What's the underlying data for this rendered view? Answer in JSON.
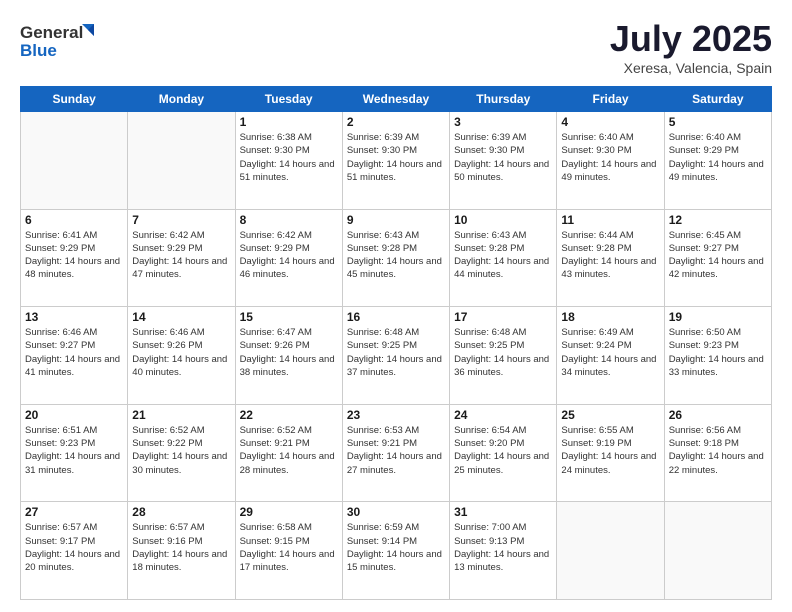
{
  "logo": {
    "line1": "General",
    "line2": "Blue"
  },
  "title": "July 2025",
  "location": "Xeresa, Valencia, Spain",
  "weekdays": [
    "Sunday",
    "Monday",
    "Tuesday",
    "Wednesday",
    "Thursday",
    "Friday",
    "Saturday"
  ],
  "days": [
    {
      "num": "",
      "info": null
    },
    {
      "num": "",
      "info": null
    },
    {
      "num": "1",
      "info": {
        "sunrise": "Sunrise: 6:38 AM",
        "sunset": "Sunset: 9:30 PM",
        "daylight": "Daylight: 14 hours and 51 minutes."
      }
    },
    {
      "num": "2",
      "info": {
        "sunrise": "Sunrise: 6:39 AM",
        "sunset": "Sunset: 9:30 PM",
        "daylight": "Daylight: 14 hours and 51 minutes."
      }
    },
    {
      "num": "3",
      "info": {
        "sunrise": "Sunrise: 6:39 AM",
        "sunset": "Sunset: 9:30 PM",
        "daylight": "Daylight: 14 hours and 50 minutes."
      }
    },
    {
      "num": "4",
      "info": {
        "sunrise": "Sunrise: 6:40 AM",
        "sunset": "Sunset: 9:30 PM",
        "daylight": "Daylight: 14 hours and 49 minutes."
      }
    },
    {
      "num": "5",
      "info": {
        "sunrise": "Sunrise: 6:40 AM",
        "sunset": "Sunset: 9:29 PM",
        "daylight": "Daylight: 14 hours and 49 minutes."
      }
    },
    {
      "num": "6",
      "info": {
        "sunrise": "Sunrise: 6:41 AM",
        "sunset": "Sunset: 9:29 PM",
        "daylight": "Daylight: 14 hours and 48 minutes."
      }
    },
    {
      "num": "7",
      "info": {
        "sunrise": "Sunrise: 6:42 AM",
        "sunset": "Sunset: 9:29 PM",
        "daylight": "Daylight: 14 hours and 47 minutes."
      }
    },
    {
      "num": "8",
      "info": {
        "sunrise": "Sunrise: 6:42 AM",
        "sunset": "Sunset: 9:29 PM",
        "daylight": "Daylight: 14 hours and 46 minutes."
      }
    },
    {
      "num": "9",
      "info": {
        "sunrise": "Sunrise: 6:43 AM",
        "sunset": "Sunset: 9:28 PM",
        "daylight": "Daylight: 14 hours and 45 minutes."
      }
    },
    {
      "num": "10",
      "info": {
        "sunrise": "Sunrise: 6:43 AM",
        "sunset": "Sunset: 9:28 PM",
        "daylight": "Daylight: 14 hours and 44 minutes."
      }
    },
    {
      "num": "11",
      "info": {
        "sunrise": "Sunrise: 6:44 AM",
        "sunset": "Sunset: 9:28 PM",
        "daylight": "Daylight: 14 hours and 43 minutes."
      }
    },
    {
      "num": "12",
      "info": {
        "sunrise": "Sunrise: 6:45 AM",
        "sunset": "Sunset: 9:27 PM",
        "daylight": "Daylight: 14 hours and 42 minutes."
      }
    },
    {
      "num": "13",
      "info": {
        "sunrise": "Sunrise: 6:46 AM",
        "sunset": "Sunset: 9:27 PM",
        "daylight": "Daylight: 14 hours and 41 minutes."
      }
    },
    {
      "num": "14",
      "info": {
        "sunrise": "Sunrise: 6:46 AM",
        "sunset": "Sunset: 9:26 PM",
        "daylight": "Daylight: 14 hours and 40 minutes."
      }
    },
    {
      "num": "15",
      "info": {
        "sunrise": "Sunrise: 6:47 AM",
        "sunset": "Sunset: 9:26 PM",
        "daylight": "Daylight: 14 hours and 38 minutes."
      }
    },
    {
      "num": "16",
      "info": {
        "sunrise": "Sunrise: 6:48 AM",
        "sunset": "Sunset: 9:25 PM",
        "daylight": "Daylight: 14 hours and 37 minutes."
      }
    },
    {
      "num": "17",
      "info": {
        "sunrise": "Sunrise: 6:48 AM",
        "sunset": "Sunset: 9:25 PM",
        "daylight": "Daylight: 14 hours and 36 minutes."
      }
    },
    {
      "num": "18",
      "info": {
        "sunrise": "Sunrise: 6:49 AM",
        "sunset": "Sunset: 9:24 PM",
        "daylight": "Daylight: 14 hours and 34 minutes."
      }
    },
    {
      "num": "19",
      "info": {
        "sunrise": "Sunrise: 6:50 AM",
        "sunset": "Sunset: 9:23 PM",
        "daylight": "Daylight: 14 hours and 33 minutes."
      }
    },
    {
      "num": "20",
      "info": {
        "sunrise": "Sunrise: 6:51 AM",
        "sunset": "Sunset: 9:23 PM",
        "daylight": "Daylight: 14 hours and 31 minutes."
      }
    },
    {
      "num": "21",
      "info": {
        "sunrise": "Sunrise: 6:52 AM",
        "sunset": "Sunset: 9:22 PM",
        "daylight": "Daylight: 14 hours and 30 minutes."
      }
    },
    {
      "num": "22",
      "info": {
        "sunrise": "Sunrise: 6:52 AM",
        "sunset": "Sunset: 9:21 PM",
        "daylight": "Daylight: 14 hours and 28 minutes."
      }
    },
    {
      "num": "23",
      "info": {
        "sunrise": "Sunrise: 6:53 AM",
        "sunset": "Sunset: 9:21 PM",
        "daylight": "Daylight: 14 hours and 27 minutes."
      }
    },
    {
      "num": "24",
      "info": {
        "sunrise": "Sunrise: 6:54 AM",
        "sunset": "Sunset: 9:20 PM",
        "daylight": "Daylight: 14 hours and 25 minutes."
      }
    },
    {
      "num": "25",
      "info": {
        "sunrise": "Sunrise: 6:55 AM",
        "sunset": "Sunset: 9:19 PM",
        "daylight": "Daylight: 14 hours and 24 minutes."
      }
    },
    {
      "num": "26",
      "info": {
        "sunrise": "Sunrise: 6:56 AM",
        "sunset": "Sunset: 9:18 PM",
        "daylight": "Daylight: 14 hours and 22 minutes."
      }
    },
    {
      "num": "27",
      "info": {
        "sunrise": "Sunrise: 6:57 AM",
        "sunset": "Sunset: 9:17 PM",
        "daylight": "Daylight: 14 hours and 20 minutes."
      }
    },
    {
      "num": "28",
      "info": {
        "sunrise": "Sunrise: 6:57 AM",
        "sunset": "Sunset: 9:16 PM",
        "daylight": "Daylight: 14 hours and 18 minutes."
      }
    },
    {
      "num": "29",
      "info": {
        "sunrise": "Sunrise: 6:58 AM",
        "sunset": "Sunset: 9:15 PM",
        "daylight": "Daylight: 14 hours and 17 minutes."
      }
    },
    {
      "num": "30",
      "info": {
        "sunrise": "Sunrise: 6:59 AM",
        "sunset": "Sunset: 9:14 PM",
        "daylight": "Daylight: 14 hours and 15 minutes."
      }
    },
    {
      "num": "31",
      "info": {
        "sunrise": "Sunrise: 7:00 AM",
        "sunset": "Sunset: 9:13 PM",
        "daylight": "Daylight: 14 hours and 13 minutes."
      }
    },
    {
      "num": "",
      "info": null
    },
    {
      "num": "",
      "info": null
    }
  ]
}
